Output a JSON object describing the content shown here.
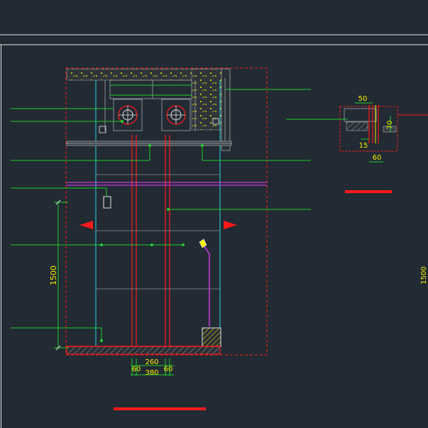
{
  "drawing": {
    "background": "#222a33",
    "colors": {
      "white": "#e6e6e6",
      "cyan": "#2ad6e0",
      "green": "#1fcf2a",
      "red": "#ff1a1a",
      "yellow": "#f4f000",
      "magenta": "#c33bd9",
      "gray": "#8a8f95",
      "dark_fill": "#2a2f36"
    },
    "main_view": {
      "vertical_dimension": "1500",
      "bottom_dimensions": {
        "center_span": "260",
        "left_offset": "60",
        "right_offset": "60",
        "overall": "380"
      }
    },
    "detail_view": {
      "top_dimension": "50",
      "side_dimension": "70",
      "small_dimension": "15",
      "bottom_dimension": "60"
    },
    "cut_off_label": "1500"
  }
}
